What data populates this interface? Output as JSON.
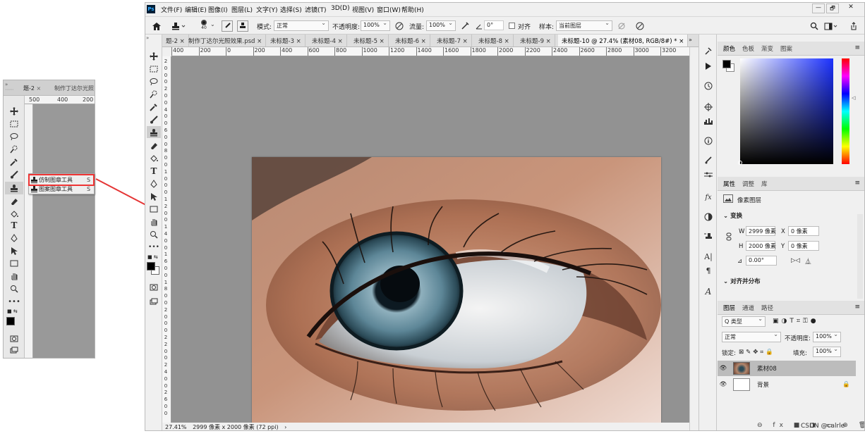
{
  "zoom_panel": {
    "tabs": [
      "题-2",
      "制作丁达尔光照"
    ],
    "ruler": [
      "500",
      "400",
      "200"
    ],
    "flyout": {
      "items": [
        {
          "label": "仿制图章工具",
          "shortcut": "S"
        },
        {
          "label": "图案图章工具",
          "shortcut": "S"
        }
      ]
    }
  },
  "menu": [
    "文件(F)",
    "编辑(E)",
    "图像(I)",
    "图层(L)",
    "文字(Y)",
    "选择(S)",
    "滤镜(T)",
    "3D(D)",
    "视图(V)",
    "窗口(W)",
    "帮助(H)"
  ],
  "app_icon": "Ps",
  "window_controls": {
    "minimize": "—",
    "restore": "🗗",
    "close": "✕"
  },
  "options": {
    "brush_size": "40",
    "mode_label": "模式:",
    "mode_value": "正常",
    "opacity_label": "不透明度:",
    "opacity_value": "100%",
    "flow_label": "流量:",
    "flow_value": "100%",
    "angle_value": "0°",
    "align_label": "对齐",
    "sample_label": "样本:",
    "sample_value": "当前图层"
  },
  "doc_tabs": [
    "题-2",
    "制作丁达尔光照效果.psd",
    "未标题-3",
    "未标题-4",
    "未标题-5",
    "未标题-6",
    "未标题-7",
    "未标题-8",
    "未标题-9",
    "未标题-10 @ 27.4% (素材08, RGB/8#) *"
  ],
  "ruler_h": [
    "400",
    "200",
    "0",
    "200",
    "400",
    "600",
    "800",
    "1000",
    "1200",
    "1400",
    "1600",
    "1800",
    "2000",
    "2200",
    "2400",
    "2600",
    "2800",
    "3000",
    "3200"
  ],
  "ruler_v": [
    "2",
    "0",
    "0",
    "0",
    "2",
    "0",
    "0",
    "4",
    "0",
    "0",
    "6",
    "0",
    "0",
    "8",
    "0",
    "0",
    "1",
    "0",
    "0",
    "0",
    "1",
    "2",
    "0",
    "0",
    "1",
    "4",
    "0",
    "0",
    "1",
    "6",
    "0",
    "0",
    "1",
    "8",
    "0",
    "0",
    "2",
    "0",
    "0",
    "0",
    "2",
    "2",
    "0",
    "0",
    "2",
    "4",
    "0",
    "0",
    "2",
    "6",
    "0",
    "0"
  ],
  "status": {
    "zoom": "27.41%",
    "doc_size": "2999 像素 x 2000 像素 (72 ppi)",
    "arrow": "›"
  },
  "color_panel": {
    "tabs": [
      "颜色",
      "色板",
      "渐变",
      "图案"
    ]
  },
  "properties": {
    "tabs": [
      "属性",
      "调整",
      "库"
    ],
    "type": "像素图层",
    "transform_label": "变换",
    "w_label": "W",
    "w_value": "2999 像素",
    "x_label": "X",
    "x_value": "0 像素",
    "h_label": "H",
    "h_value": "2000 像素",
    "y_label": "Y",
    "y_value": "0 像素",
    "angle_value": "0.00°",
    "align_label": "对齐并分布"
  },
  "layers": {
    "tabs": [
      "图层",
      "通道",
      "路径"
    ],
    "filter_label": "Q 类型",
    "blend": "正常",
    "opacity_label": "不透明度:",
    "opacity_value": "100%",
    "lock_label": "锁定:",
    "fill_label": "填充:",
    "fill_value": "100%",
    "items": [
      {
        "name": "素材08",
        "locked": false,
        "selected": true
      },
      {
        "name": "背景",
        "locked": true,
        "selected": false
      }
    ]
  },
  "watermark": "CSDN @calrle",
  "colors": {
    "fg": "#000000",
    "bg": "#ffffff",
    "highlight": "#e53535",
    "arrow": "#e53535"
  }
}
